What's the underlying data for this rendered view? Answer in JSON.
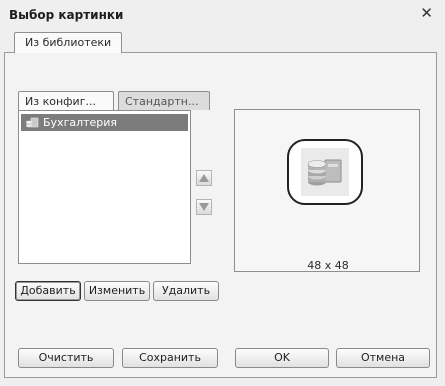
{
  "window": {
    "title": "Выбор картинки"
  },
  "tabs": {
    "top": "Из библиотеки",
    "config": "Из конфиг...",
    "standard": "Стандартн..."
  },
  "list": {
    "items": [
      {
        "label": "Бухгалтерия",
        "selected": true,
        "icon": "coins-card-icon"
      }
    ]
  },
  "preview": {
    "size": "48 x 48"
  },
  "picture_buttons": {
    "add": "Добавить",
    "edit": "Изменить",
    "delete": "Удалить"
  },
  "footer": {
    "clear": "Очистить",
    "save": "Сохранить",
    "ok": "OK",
    "cancel": "Отмена"
  }
}
